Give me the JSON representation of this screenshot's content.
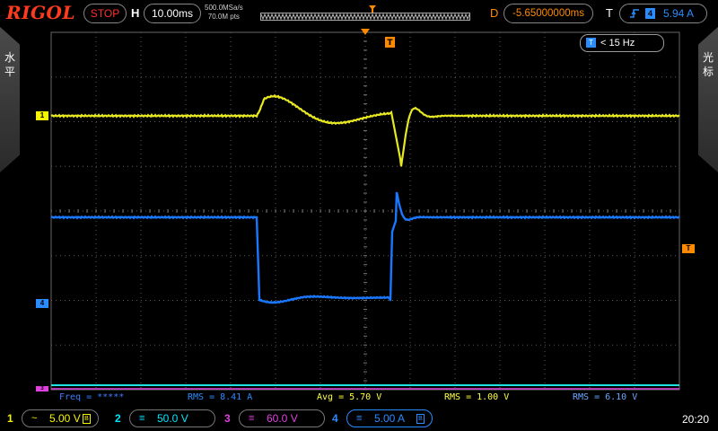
{
  "header": {
    "logo": "RIGOL",
    "run_state": "STOP",
    "horizontal_label": "H",
    "timebase": "10.00ms",
    "sample_rate": "500.0MSa/s",
    "memory_depth": "70.0M pts",
    "delay_label": "D",
    "delay": "-5.65000000ms",
    "trigger_label": "T",
    "trigger_source": "4",
    "trigger_level": "5.94 A",
    "trigger_edge_icon": "rising-edge-icon"
  },
  "side_menus": {
    "left": "水平",
    "right": "光标"
  },
  "filter_badge": {
    "icon": "T",
    "text": "< 15 Hz"
  },
  "markers": {
    "ch1": "1",
    "ch4": "4",
    "ch3": "3",
    "trigger_level": "T",
    "trigger_pos": "T"
  },
  "measurements": [
    {
      "label": "Freq = *****",
      "color": "#3a7dff"
    },
    {
      "label": "RMS = 8.41 A",
      "color": "#2a8cff"
    },
    {
      "label": "Avg = 5.70 V",
      "color": "#ffff40"
    },
    {
      "label": "RMS = 1.00 V",
      "color": "#ffff40"
    },
    {
      "label": "RMS = 6.10 V",
      "color": "#6aa8ff"
    }
  ],
  "channels": [
    {
      "num": "1",
      "coupling": "~",
      "scale": "5.00 V",
      "color": "#f5f500",
      "bw": "B"
    },
    {
      "num": "2",
      "coupling": "≡",
      "scale": "50.0 V",
      "color": "#00e5ff",
      "bw": ""
    },
    {
      "num": "3",
      "coupling": "≡",
      "scale": "60.0 V",
      "color": "#e040e0",
      "bw": ""
    },
    {
      "num": "4",
      "coupling": "≡",
      "scale": "5.00 A",
      "color": "#2a8cff",
      "bw": "B"
    }
  ],
  "clock": "20:20",
  "colors": {
    "ch1": "#e8e820",
    "ch2": "#20e0e0",
    "ch3": "#e040e0",
    "ch4": "#1a78ff",
    "accent": "#ff8a00",
    "grid": "#5a5a5a"
  }
}
